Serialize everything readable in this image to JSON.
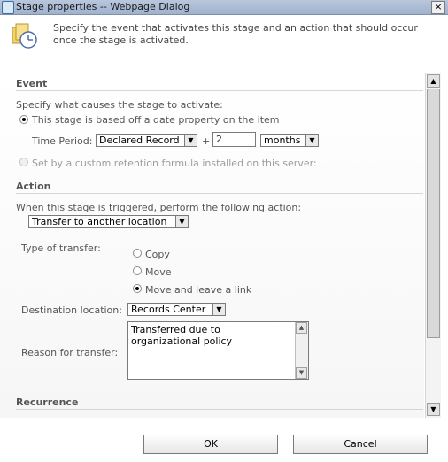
{
  "window": {
    "title": "Stage properties -- Webpage Dialog",
    "close_glyph": "×"
  },
  "header": {
    "description": "Specify the event that activates this stage and an action that should occur once the stage is activated."
  },
  "event": {
    "title": "Event",
    "instruction": "Specify what causes the stage to activate:",
    "option_date_property": "This stage is based off a date property on the item",
    "time_period_label": "Time Period:",
    "time_period_property": "Declared Record",
    "plus_sign": "+",
    "time_period_value": "2",
    "time_period_unit": "months",
    "option_custom_formula": "Set by a custom retention formula installed on this server:"
  },
  "action": {
    "title": "Action",
    "instruction": "When this stage is triggered, perform the following action:",
    "selected_action": "Transfer to another location",
    "type_label": "Type of transfer:",
    "type_options": [
      "Copy",
      "Move",
      "Move and leave a link"
    ],
    "selected_type_index": 2,
    "destination_label": "Destination location:",
    "destination_value": "Records Center",
    "reason_label": "Reason for transfer:",
    "reason_value": "Transferred due to organizational policy"
  },
  "recurrence": {
    "title": "Recurrence"
  },
  "footer": {
    "ok_label": "OK",
    "cancel_label": "Cancel"
  },
  "icons": {
    "dropdown": "▼",
    "scroll_up": "▲",
    "scroll_down": "▼"
  }
}
